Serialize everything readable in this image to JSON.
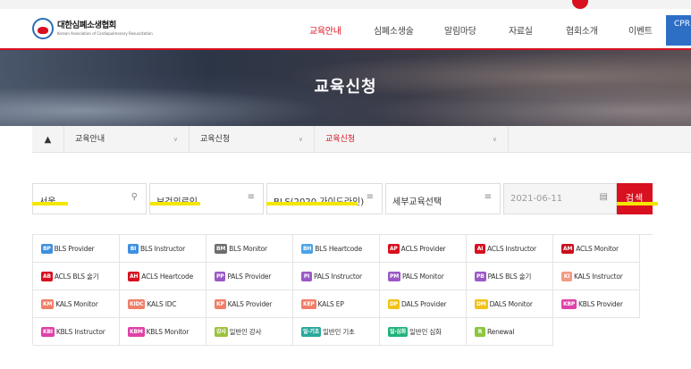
{
  "org": {
    "name_kr": "대한심폐소생협회",
    "name_en": "Korean Association of Cardiopulmonary Resuscitation"
  },
  "nav": [
    "교육안내",
    "심폐소생술",
    "알림마당",
    "자료실",
    "협회소개",
    "이벤트"
  ],
  "cpr_button": "CPR 바로",
  "hero_title": "교육신청",
  "breadcrumb": {
    "home_icon": "home-icon",
    "seg1": "교육안내",
    "seg2": "교육신청",
    "seg3": "교육신청"
  },
  "filters": {
    "region": "서울",
    "target": "보건의료인",
    "course": "BLS(2020 가이드라인)",
    "detail": "세부교육선택",
    "date": "2021-06-11",
    "search": "검색"
  },
  "courses": [
    {
      "badge": "BP",
      "color": "#3f8fe0",
      "label": "BLS Provider"
    },
    {
      "badge": "BI",
      "color": "#3f8fe0",
      "label": "BLS Instructor"
    },
    {
      "badge": "BM",
      "color": "#6d6d6d",
      "label": "BLS Monitor"
    },
    {
      "badge": "BH",
      "color": "#4aa3e8",
      "label": "BLS Heartcode"
    },
    {
      "badge": "AP",
      "color": "#d8101f",
      "label": "ACLS Provider"
    },
    {
      "badge": "AI",
      "color": "#d8101f",
      "label": "ACLS Instructor"
    },
    {
      "badge": "AM",
      "color": "#c8101c",
      "label": "ACLS Monitor"
    },
    {
      "badge": "AB",
      "color": "#d8101f",
      "label": "ACLS BLS 술기"
    },
    {
      "badge": "AH",
      "color": "#d8101f",
      "label": "ACLS Heartcode"
    },
    {
      "badge": "PP",
      "color": "#9b59c6",
      "label": "PALS Provider"
    },
    {
      "badge": "PI",
      "color": "#9b59c6",
      "label": "PALS Instructor"
    },
    {
      "badge": "PM",
      "color": "#9b59c6",
      "label": "PALS Monitor"
    },
    {
      "badge": "PB",
      "color": "#9b59c6",
      "label": "PALS BLS 술기"
    },
    {
      "badge": "KI",
      "color": "#f29a83",
      "label": "KALS Instructor"
    },
    {
      "badge": "KM",
      "color": "#f07f68",
      "label": "KALS Monitor"
    },
    {
      "badge": "KIDC",
      "color": "#f07f68",
      "label": "KALS IDC"
    },
    {
      "badge": "KP",
      "color": "#f07f68",
      "label": "KALS Provider"
    },
    {
      "badge": "KEP",
      "color": "#f07f68",
      "label": "KALS EP"
    },
    {
      "badge": "DP",
      "color": "#f2c21a",
      "label": "DALS Provider"
    },
    {
      "badge": "DM",
      "color": "#f2c21a",
      "label": "DALS Monitor"
    },
    {
      "badge": "KBP",
      "color": "#e040a8",
      "label": "KBLS Provider"
    },
    {
      "badge": "KBI",
      "color": "#e040a8",
      "label": "KBLS Instructor"
    },
    {
      "badge": "KBM",
      "color": "#e040a8",
      "label": "KBLS Monitor"
    },
    {
      "badge": "강사",
      "color": "#9bc23c",
      "label": "일반인 강사"
    },
    {
      "badge": "일·기초",
      "color": "#2aa89a",
      "label": "일반인 기초"
    },
    {
      "badge": "일·심화",
      "color": "#1fb37a",
      "label": "일반인 심화"
    },
    {
      "badge": "R",
      "color": "#8cc63f",
      "label": "Renewal"
    }
  ]
}
